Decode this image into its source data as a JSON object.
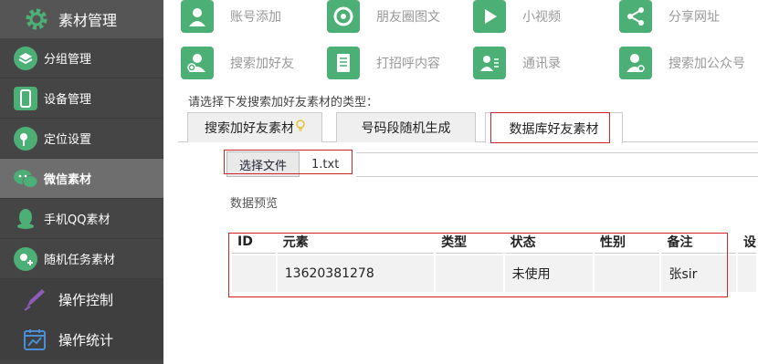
{
  "sidebar": {
    "header": "素材管理",
    "items": [
      {
        "label": "分组管理",
        "icon": "layers-icon"
      },
      {
        "label": "设备管理",
        "icon": "phone-icon"
      },
      {
        "label": "定位设置",
        "icon": "location-icon"
      },
      {
        "label": "微信素材",
        "icon": "wechat-icon",
        "active": true
      },
      {
        "label": "手机QQ素材",
        "icon": "qq-icon"
      },
      {
        "label": "随机任务素材",
        "icon": "task-icon"
      }
    ],
    "footer": [
      {
        "label": "操作控制",
        "icon": "pen-icon"
      },
      {
        "label": "操作统计",
        "icon": "stats-icon"
      }
    ]
  },
  "toolbar": {
    "account_add": "账号添加",
    "moments": "朋友圈图文",
    "video": "小视频",
    "share_url": "分享网址",
    "search_friend": "搜索加好友",
    "greeting": "打招呼内容",
    "contacts": "通讯录",
    "search_official": "搜索加公众号"
  },
  "prompt": "请选择下发搜索加好友素材的类型：",
  "tabs": {
    "tab1": "搜索加好友素材",
    "tab2": "号码段随机生成",
    "tab3": "数据库好友素材"
  },
  "file": {
    "button": "选择文件",
    "name": "1.txt"
  },
  "preview_label": "数据预览",
  "table": {
    "headers": {
      "id": "ID",
      "element": "元素",
      "type": "类型",
      "status": "状态",
      "gender": "性别",
      "remark": "备注",
      "more": "设"
    },
    "row": {
      "id": "",
      "element": "13620381278",
      "type": "",
      "status": "未使用",
      "gender": "",
      "remark": "张sir"
    }
  },
  "colors": {
    "accent": "#4caf76",
    "sidebar": "#454545",
    "highlight": "#d2232a"
  }
}
